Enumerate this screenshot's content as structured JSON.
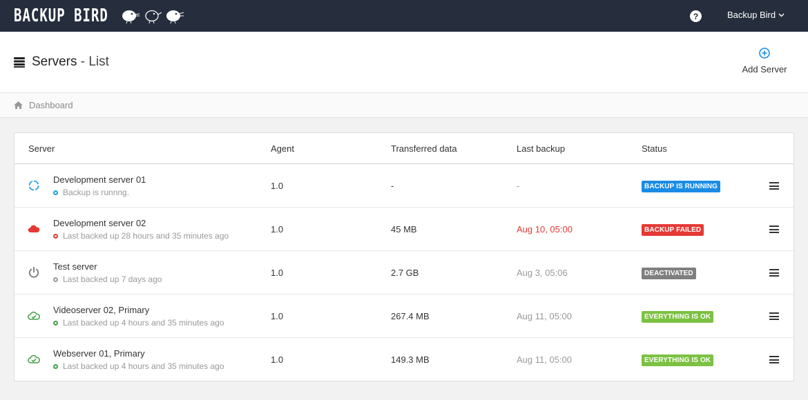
{
  "app": {
    "logo_text": "BACKUP BIRD",
    "user_label": "Backup Bird",
    "help_label": "?"
  },
  "header": {
    "title": "Servers",
    "title_suffix": "- List",
    "add_label": "Add Server"
  },
  "breadcrumb": {
    "home_label": "Dashboard"
  },
  "table": {
    "columns": {
      "server": "Server",
      "agent": "Agent",
      "data": "Transferred data",
      "last": "Last backup",
      "status": "Status"
    },
    "rows": [
      {
        "name": "Development server 01",
        "sub": "Backup is runnng.",
        "agent": "1.0",
        "data": "-",
        "last": "-",
        "status": "BACKUP IS RUNNING",
        "icon": "spinner-icon",
        "icon_color": "#1aa0dd",
        "dot_color": "#1aa0dd",
        "badge_color": "#1a8ce6",
        "last_state": "neutral"
      },
      {
        "name": "Development server 02",
        "sub": "Last backed up 28 hours and 35 minutes ago",
        "agent": "1.0",
        "data": "45 MB",
        "last": "Aug 10, 05:00",
        "status": "BACKUP FAILED",
        "icon": "cloud-icon",
        "icon_color": "#e53935",
        "dot_color": "#e53935",
        "badge_color": "#e53935",
        "last_state": "failed"
      },
      {
        "name": "Test server",
        "sub": "Last backed up 7 days ago",
        "agent": "1.0",
        "data": "2.7 GB",
        "last": "Aug 3, 05:06",
        "status": "DEACTIVATED",
        "icon": "power-icon",
        "icon_color": "#777777",
        "dot_color": "#999999",
        "badge_color": "#7f7f7f",
        "last_state": "neutral"
      },
      {
        "name": "Videoserver 02, Primary",
        "sub": "Last backed up 4 hours and 35 minutes ago",
        "agent": "1.0",
        "data": "267.4 MB",
        "last": "Aug 11, 05:00",
        "status": "EVERYTHING IS OK",
        "icon": "cloud-check-icon",
        "icon_color": "#43a047",
        "dot_color": "#43a047",
        "badge_color": "#7cc142",
        "last_state": "neutral"
      },
      {
        "name": "Webserver 01, Primary",
        "sub": "Last backed up 4 hours and 35 minutes ago",
        "agent": "1.0",
        "data": "149.3 MB",
        "last": "Aug 11, 05:00",
        "status": "EVERYTHING IS OK",
        "icon": "cloud-check-icon",
        "icon_color": "#43a047",
        "dot_color": "#43a047",
        "badge_color": "#7cc142",
        "last_state": "neutral"
      }
    ]
  }
}
